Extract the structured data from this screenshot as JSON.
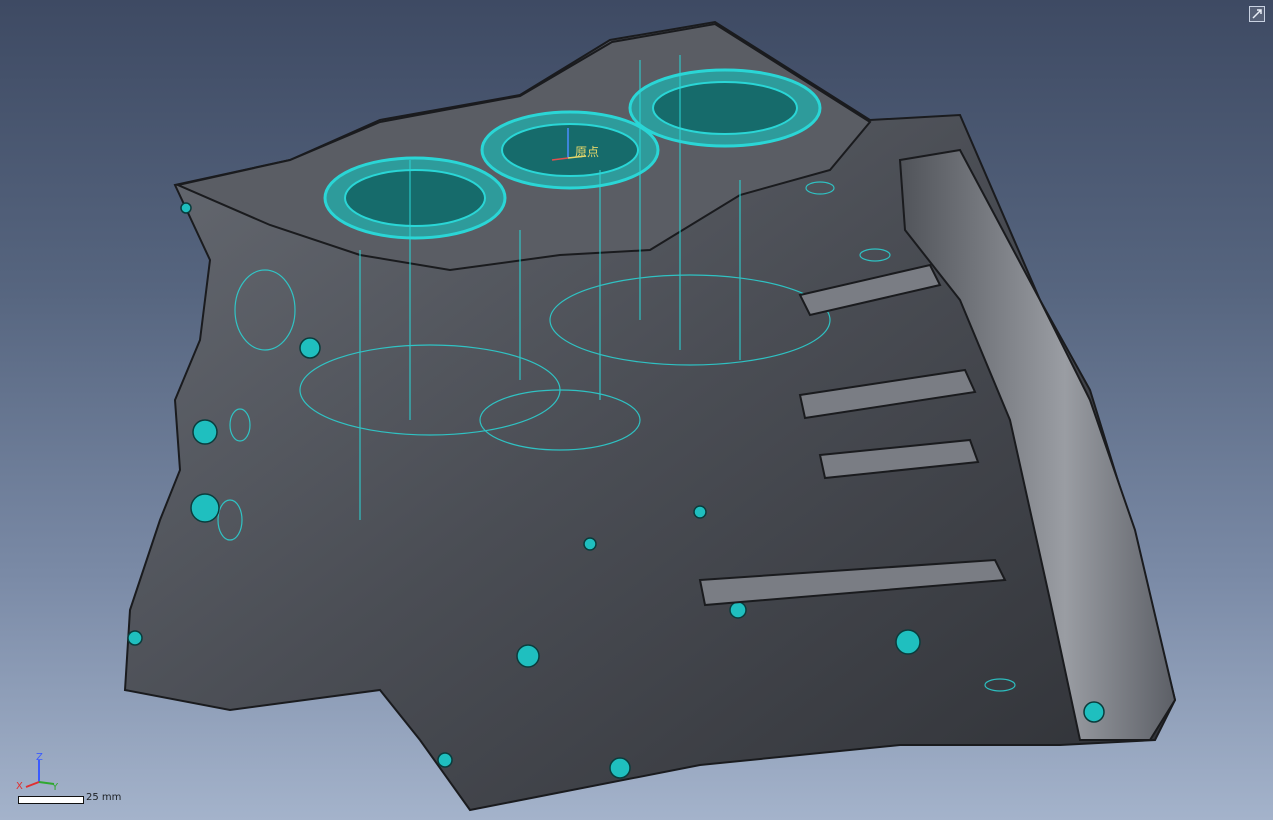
{
  "viewport": {
    "background_top": "#3e4a63",
    "background_bottom": "#a4b3cb",
    "model_color": "#4d5057",
    "edge_color": "#2ad6d6"
  },
  "origin_marker": {
    "label": "原点"
  },
  "triad": {
    "x": "X",
    "y": "Y",
    "z": "Z"
  },
  "scale": {
    "label": "25 mm"
  },
  "corner_button": {
    "icon": "expand-icon"
  }
}
